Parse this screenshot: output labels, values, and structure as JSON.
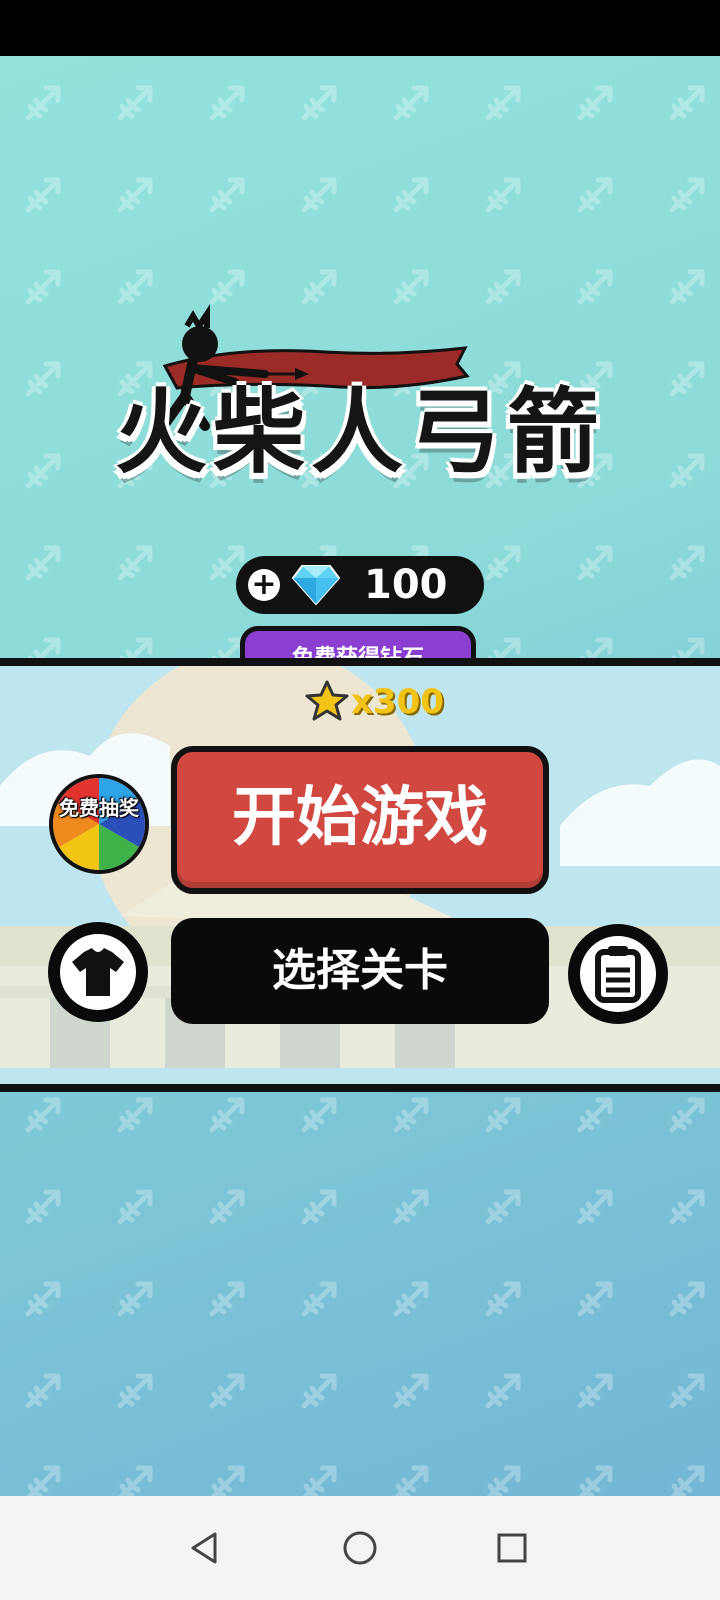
{
  "game": {
    "title": "火柴人弓箭",
    "gems": {
      "count": "100",
      "plus": "+"
    },
    "free_gem_label": "免费获得钻石",
    "stars": "x300",
    "start_label": "开始游戏",
    "select_level_label": "选择关卡",
    "lottery_label": "免费抽奖"
  },
  "icons": {
    "gem": "diamond-icon",
    "star": "star-icon",
    "skin": "tshirt-icon",
    "tasks": "clipboard-icon",
    "back": "nav-back-icon",
    "home": "nav-home-icon",
    "recents": "nav-recents-icon"
  },
  "colors": {
    "bg_top": "#93e2dc",
    "bg_bottom": "#74b6d4",
    "start_button": "#d14841",
    "free_gem_button": "#8a3fd0",
    "star": "#f3c418"
  }
}
